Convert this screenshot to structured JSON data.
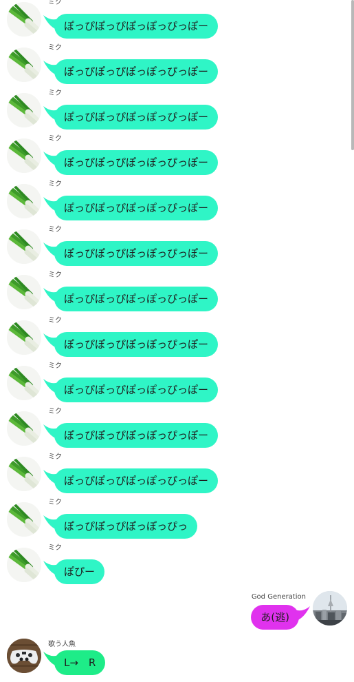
{
  "colors": {
    "miku_bubble": "#2ff5c6",
    "god_bubble": "#e032ee",
    "singer_bubble": "#1eec88",
    "text": "#1e1e1e",
    "sender_text": "#444444",
    "scrollbar": "#b8b8b8"
  },
  "messages": [
    {
      "sender": "ミク",
      "text": "ぽっぴぽっぴぽっぽっぴっぽー",
      "avatar_icon": "green-onion-icon"
    },
    {
      "sender": "ミク",
      "text": "ぽっぴぽっぴぽっぽっぴっぽー",
      "avatar_icon": "green-onion-icon"
    },
    {
      "sender": "ミク",
      "text": "ぽっぴぽっぴぽっぽっぴっぽー",
      "avatar_icon": "green-onion-icon"
    },
    {
      "sender": "ミク",
      "text": "ぽっぴぽっぴぽっぽっぴっぽー",
      "avatar_icon": "green-onion-icon"
    },
    {
      "sender": "ミク",
      "text": "ぽっぴぽっぴぽっぽっぴっぽー",
      "avatar_icon": "green-onion-icon"
    },
    {
      "sender": "ミク",
      "text": "ぽっぴぽっぴぽっぽっぴっぽー",
      "avatar_icon": "green-onion-icon"
    },
    {
      "sender": "ミク",
      "text": "ぽっぴぽっぴぽっぽっぴっぽー",
      "avatar_icon": "green-onion-icon"
    },
    {
      "sender": "ミク",
      "text": "ぽっぴぽっぴぽっぽっぴっぽー",
      "avatar_icon": "green-onion-icon"
    },
    {
      "sender": "ミク",
      "text": "ぽっぴぽっぴぽっぽっぴっぽー",
      "avatar_icon": "green-onion-icon"
    },
    {
      "sender": "ミク",
      "text": "ぽっぴぽっぴぽっぽっぴっぽー",
      "avatar_icon": "green-onion-icon"
    },
    {
      "sender": "ミク",
      "text": "ぽっぴぽっぴぽっぽっぴっぽー",
      "avatar_icon": "green-onion-icon"
    },
    {
      "sender": "ミク",
      "text": "ぽっぴぽっぴぽっぽっぴっ",
      "avatar_icon": "green-onion-icon"
    },
    {
      "sender": "ミク",
      "text": "ぽぴー",
      "avatar_icon": "green-onion-icon"
    }
  ],
  "god_message": {
    "sender": "God Generation",
    "text": "あ(逃)",
    "avatar_icon": "city-tower-photo-icon"
  },
  "singer_message": {
    "sender": "歌う人魚",
    "text": "L→　R",
    "avatar_icon": "game-controller-icon"
  }
}
